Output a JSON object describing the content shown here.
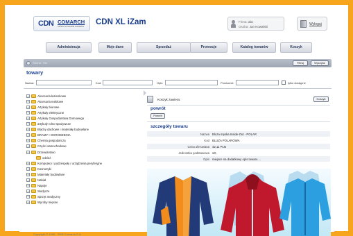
{
  "header": {
    "logo": {
      "brand_prefix": "CDN",
      "brand_name": "COMARCH",
      "brand_tagline": "SPÓŁKA W GRUPIE COMARCH"
    },
    "app_title": "CDN XL iZam",
    "user": {
      "firma_label": "Firma:",
      "firma_value": "abc",
      "osoba_label": "Osoba:",
      "osoba_value": "Jan Kowalski"
    },
    "logout_label": "Wyloguj"
  },
  "nav": [
    "Administracja",
    "Moje dane",
    "Sprzedaż",
    "Promocje",
    "Katalog towarów",
    "Koszyk"
  ],
  "search_bar": {
    "crumb": "Strona / Hm",
    "filter_button": "Filtruj",
    "clear_button": "Wyczyść"
  },
  "filters": {
    "title": "towary",
    "name_label": "Nazwa:",
    "code_label": "Kod:",
    "desc_label": "Opis:",
    "producer_label": "Producent:",
    "only_available_label": "tylko dostępne"
  },
  "tree": [
    {
      "label": "Akcesoria łazienkowe",
      "sub": false
    },
    {
      "label": "Akcesoria meblowe",
      "sub": false
    },
    {
      "label": "Artykuły biurowe",
      "sub": false
    },
    {
      "label": "Artykuły elektryczne",
      "sub": false
    },
    {
      "label": "Artykuły Gospodarstwa Domowego",
      "sub": false
    },
    {
      "label": "artykuły rolno-spożywcze",
      "sub": false
    },
    {
      "label": "Blachy dachowe i materiały budowlane",
      "sub": false
    },
    {
      "label": "BRAMY I OGRODZENIA",
      "sub": false
    },
    {
      "label": "Chemia gospodarcza",
      "sub": false
    },
    {
      "label": "Części samochodowe",
      "sub": false
    },
    {
      "label": "Drzewiarstwo",
      "sub": false
    },
    {
      "label": "odzież",
      "sub": true
    },
    {
      "label": "Komputery / podzespoły / urządzenia peryferyjne",
      "sub": false
    },
    {
      "label": "Kosmetyki",
      "sub": false
    },
    {
      "label": "Materiały budowlane",
      "sub": false
    },
    {
      "label": "Nabiał",
      "sub": false
    },
    {
      "label": "Napoje",
      "sub": false
    },
    {
      "label": "Słodycze",
      "sub": false
    },
    {
      "label": "Sprzęt medyczny",
      "sub": false
    },
    {
      "label": "Wyroby mięsne",
      "sub": false
    }
  ],
  "cart": {
    "label": "Koszyk zawiera:",
    "button": "Koszyk"
  },
  "back": {
    "title": "powrót",
    "button": "Powrót"
  },
  "details": {
    "title": "szczegóły towaru",
    "rows": [
      {
        "label": "Nazwa",
        "value": "Bluza męska Inside-Out - POLAR"
      },
      {
        "label": "Kod",
        "value": "BLUZA POLAROWA"
      },
      {
        "label": "Cena oferowana",
        "value": "42,11 PLN"
      },
      {
        "label": "Jednostka podstawowa",
        "value": "szt."
      },
      {
        "label": "Opis",
        "value": "miejsce na dodatkowy opis towaru...."
      }
    ]
  },
  "footer": "Copyright © 1996 - 2008 Comarch S.A.",
  "colors": {
    "frame": "#f7a51c",
    "brand": "#1b3e8e",
    "accent": "#e8731a"
  }
}
